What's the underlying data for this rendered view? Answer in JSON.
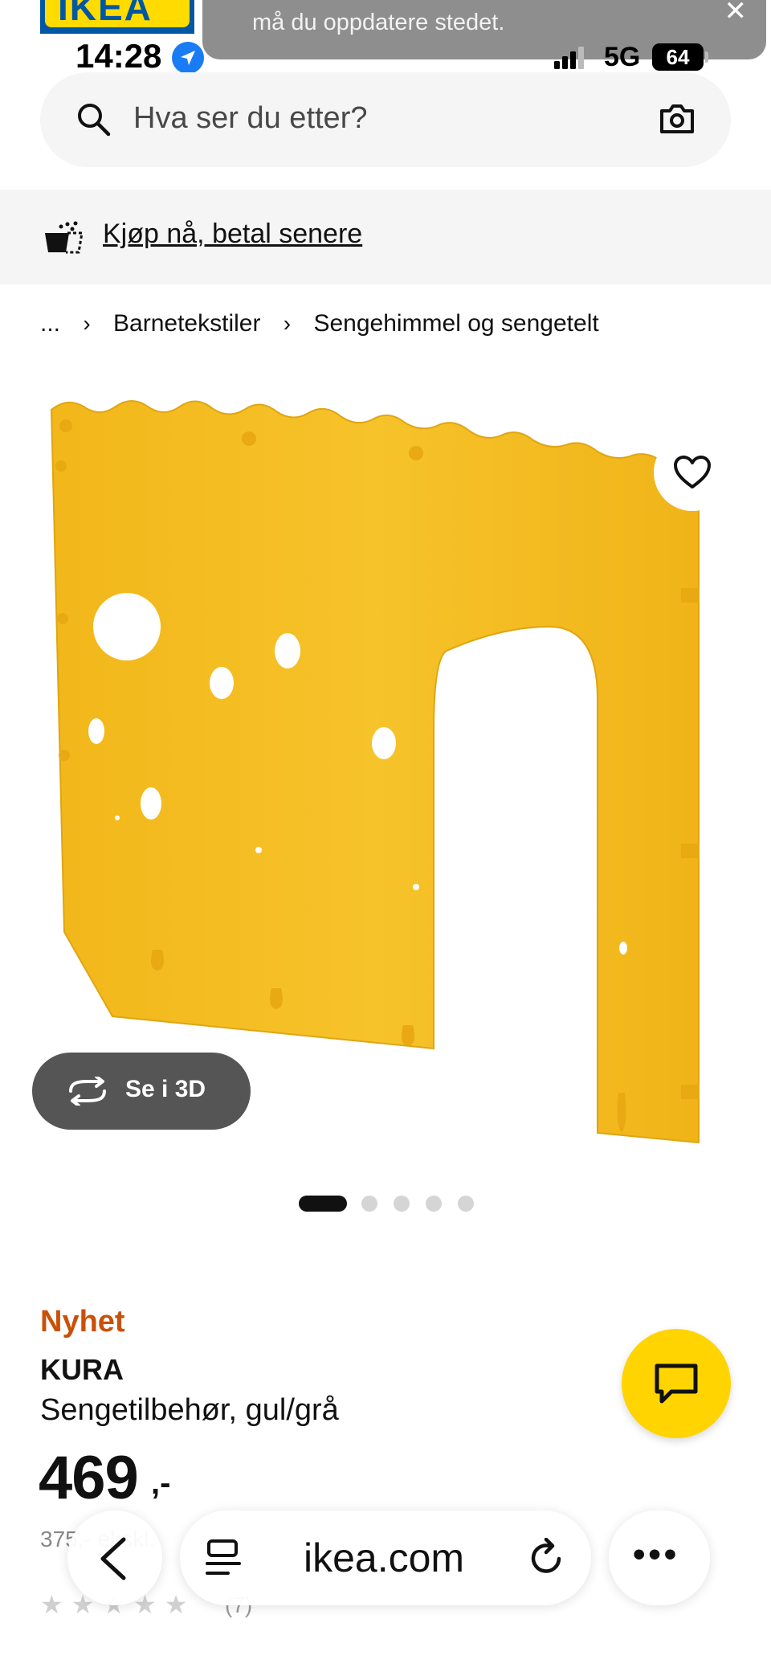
{
  "status_bar": {
    "time": "14:28",
    "network": "5G",
    "battery": "64"
  },
  "notification": {
    "text": "må du oppdatere stedet.",
    "close": "✕"
  },
  "search": {
    "placeholder": "Hva ser du etter?"
  },
  "pay_later": {
    "label": "Kjøp nå, betal senere"
  },
  "breadcrumb": {
    "ellipsis": "...",
    "separator": "›",
    "items": [
      "Barnetekstiler",
      "Sengehimmel og sengetelt"
    ]
  },
  "product": {
    "see_3d_label": "Se i 3D",
    "new_badge": "Nyhet",
    "name": "KURA",
    "description": "Sengetilbehør, gul/grå",
    "price": "469",
    "price_suffix": ",-",
    "price_ex_vat": "375,- ekskl.",
    "rating_count": "(7)",
    "rating_value": 0,
    "image_count": 5,
    "active_image_index": 0
  },
  "browser": {
    "url": "ikea.com",
    "more": "•••"
  },
  "colors": {
    "accent_new": "#ca5008",
    "chat_button": "#ffd400",
    "product_yellow": "#f5bf1f",
    "ikea_blue": "#0058a3",
    "ikea_yellow": "#ffdb00"
  }
}
